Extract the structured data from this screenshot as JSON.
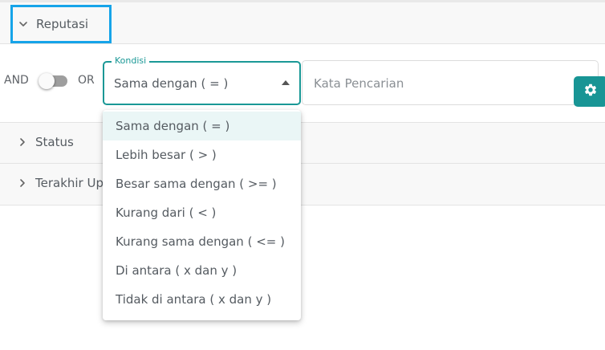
{
  "sections": {
    "reputasi": "Reputasi",
    "status": "Status",
    "terakhir_update": "Terakhir Update"
  },
  "filter": {
    "and_label": "AND",
    "or_label": "OR",
    "toggle_state": "off",
    "condition_label": "Kondisi",
    "condition_value": "Sama dengan ( = )",
    "search_placeholder": "Kata Pencarian"
  },
  "dropdown": {
    "options": [
      "Sama dengan ( = )",
      "Lebih besar ( > )",
      "Besar sama dengan ( >= )",
      "Kurang dari ( < )",
      "Kurang sama dengan ( <= )",
      "Di antara ( x dan y )",
      "Tidak di antara ( x dan y )"
    ],
    "selected_index": 0
  },
  "colors": {
    "accent": "#1a9896",
    "focus": "#16a4e9",
    "settings_button": "#189595"
  },
  "icons": {
    "expand_reputasi": "chevron-down-icon",
    "expand_status": "chevron-right-icon",
    "expand_terakhir": "chevron-right-icon",
    "settings": "gear-icon",
    "dropdown": "caret-up-icon"
  }
}
